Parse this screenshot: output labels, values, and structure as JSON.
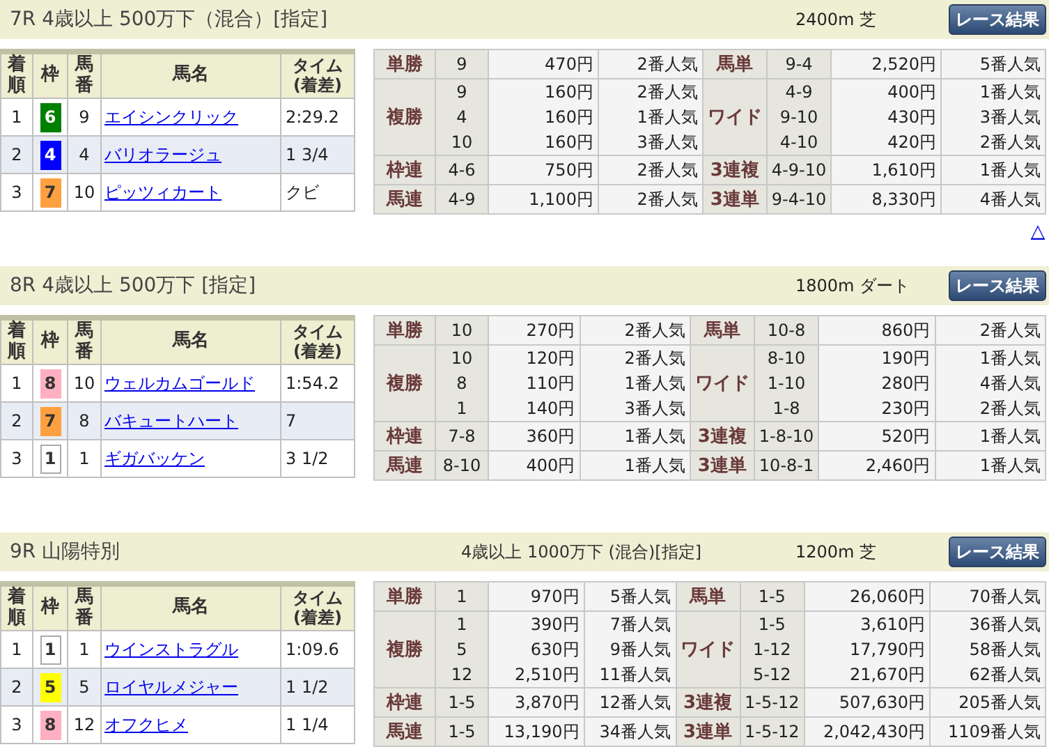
{
  "races": [
    {
      "title": "7R 4歳以上 500万下（混合）[指定]",
      "distance": "2400m 芝",
      "button": "レース結果",
      "columns": [
        "着順",
        "枠",
        "馬番",
        "馬名",
        "タイム(着差)"
      ],
      "results": [
        {
          "place": "1",
          "frame": "6",
          "color": "#008000",
          "number": "9",
          "name": "エイシンクリック",
          "time": "2:29.2"
        },
        {
          "place": "2",
          "frame": "4",
          "color": "#0000ff",
          "number": "4",
          "name": "バリオラージュ",
          "time": "1 3/4"
        },
        {
          "place": "3",
          "frame": "7",
          "color": "#ffa040",
          "number": "10",
          "name": "ピッツィカート",
          "time": "クビ"
        }
      ],
      "payouts": [
        {
          "label": "単勝",
          "entries": [
            {
              "combo": "9",
              "amount": "470円",
              "rank": "2番人気"
            }
          ],
          "label_2": "馬単",
          "entries_2": [
            {
              "combo": "9-4",
              "amount": "2,520円",
              "rank": "5番人気"
            }
          ]
        },
        {
          "label": "複勝",
          "entries": [
            {
              "combo": "9",
              "amount": "160円",
              "rank": "2番人気"
            },
            {
              "combo": "4",
              "amount": "160円",
              "rank": "1番人気"
            },
            {
              "combo": "10",
              "amount": "160円",
              "rank": "3番人気"
            }
          ],
          "label_2": "ワイド",
          "entries_2": [
            {
              "combo": "4-9",
              "amount": "400円",
              "rank": "1番人気"
            },
            {
              "combo": "9-10",
              "amount": "430円",
              "rank": "3番人気"
            },
            {
              "combo": "4-10",
              "amount": "420円",
              "rank": "2番人気"
            }
          ]
        },
        {
          "label": "枠連",
          "entries": [
            {
              "combo": "4-6",
              "amount": "750円",
              "rank": "2番人気"
            }
          ],
          "label_2": "3連複",
          "entries_2": [
            {
              "combo": "4-9-10",
              "amount": "1,610円",
              "rank": "1番人気"
            }
          ]
        },
        {
          "label": "馬連",
          "entries": [
            {
              "combo": "4-9",
              "amount": "1,100円",
              "rank": "2番人気"
            }
          ],
          "label_2": "3連単",
          "entries_2": [
            {
              "combo": "9-4-10",
              "amount": "8,330円",
              "rank": "4番人気"
            }
          ]
        }
      ],
      "back_link": "△"
    },
    {
      "title": "8R 4歳以上 500万下 [指定]",
      "distance": "1800m ダート",
      "button": "レース結果",
      "columns": [
        "着順",
        "枠",
        "馬番",
        "馬名",
        "タイム(着差)"
      ],
      "results": [
        {
          "place": "1",
          "frame": "8",
          "color": "#ffb0c0",
          "number": "10",
          "name": "ウェルカムゴールド",
          "time": "1:54.2"
        },
        {
          "place": "2",
          "frame": "7",
          "color": "#ffa040",
          "number": "8",
          "name": "バキュートハート",
          "time": "7"
        },
        {
          "place": "3",
          "frame": "1",
          "color": "#ffffff",
          "number": "1",
          "name": "ギガバッケン",
          "time": "3 1/2"
        }
      ],
      "payouts": [
        {
          "label": "単勝",
          "entries": [
            {
              "combo": "10",
              "amount": "270円",
              "rank": "2番人気"
            }
          ],
          "label_2": "馬単",
          "entries_2": [
            {
              "combo": "10-8",
              "amount": "860円",
              "rank": "2番人気"
            }
          ]
        },
        {
          "label": "複勝",
          "entries": [
            {
              "combo": "10",
              "amount": "120円",
              "rank": "2番人気"
            },
            {
              "combo": "8",
              "amount": "110円",
              "rank": "1番人気"
            },
            {
              "combo": "1",
              "amount": "140円",
              "rank": "3番人気"
            }
          ],
          "label_2": "ワイド",
          "entries_2": [
            {
              "combo": "8-10",
              "amount": "190円",
              "rank": "1番人気"
            },
            {
              "combo": "1-10",
              "amount": "280円",
              "rank": "4番人気"
            },
            {
              "combo": "1-8",
              "amount": "230円",
              "rank": "2番人気"
            }
          ]
        },
        {
          "label": "枠連",
          "entries": [
            {
              "combo": "7-8",
              "amount": "360円",
              "rank": "1番人気"
            }
          ],
          "label_2": "3連複",
          "entries_2": [
            {
              "combo": "1-8-10",
              "amount": "520円",
              "rank": "1番人気"
            }
          ]
        },
        {
          "label": "馬連",
          "entries": [
            {
              "combo": "8-10",
              "amount": "400円",
              "rank": "1番人気"
            }
          ],
          "label_2": "3連単",
          "entries_2": [
            {
              "combo": "10-8-1",
              "amount": "2,460円",
              "rank": "1番人気"
            }
          ]
        }
      ]
    },
    {
      "title": "9R 山陽特別",
      "subtitle": "4歳以上 1000万下 (混合)[指定]",
      "distance": "1200m 芝",
      "button": "レース結果",
      "columns": [
        "着順",
        "枠",
        "馬番",
        "馬名",
        "タイム(着差)"
      ],
      "results": [
        {
          "place": "1",
          "frame": "1",
          "color": "#ffffff",
          "number": "1",
          "name": "ウインストラグル",
          "time": "1:09.6"
        },
        {
          "place": "2",
          "frame": "5",
          "color": "#ffff00",
          "number": "5",
          "name": "ロイヤルメジャー",
          "time": "1 1/2"
        },
        {
          "place": "3",
          "frame": "8",
          "color": "#ffb0c0",
          "number": "12",
          "name": "オフクヒメ",
          "time": "1 1/4"
        }
      ],
      "payouts": [
        {
          "label": "単勝",
          "entries": [
            {
              "combo": "1",
              "amount": "970円",
              "rank": "5番人気"
            }
          ],
          "label_2": "馬単",
          "entries_2": [
            {
              "combo": "1-5",
              "amount": "26,060円",
              "rank": "70番人気"
            }
          ]
        },
        {
          "label": "複勝",
          "entries": [
            {
              "combo": "1",
              "amount": "390円",
              "rank": "7番人気"
            },
            {
              "combo": "5",
              "amount": "630円",
              "rank": "9番人気"
            },
            {
              "combo": "12",
              "amount": "2,510円",
              "rank": "11番人気"
            }
          ],
          "label_2": "ワイド",
          "entries_2": [
            {
              "combo": "1-5",
              "amount": "3,610円",
              "rank": "36番人気"
            },
            {
              "combo": "1-12",
              "amount": "17,790円",
              "rank": "58番人気"
            },
            {
              "combo": "5-12",
              "amount": "21,670円",
              "rank": "62番人気"
            }
          ]
        },
        {
          "label": "枠連",
          "entries": [
            {
              "combo": "1-5",
              "amount": "3,870円",
              "rank": "12番人気"
            }
          ],
          "label_2": "3連複",
          "entries_2": [
            {
              "combo": "1-5-12",
              "amount": "507,630円",
              "rank": "205番人気"
            }
          ]
        },
        {
          "label": "馬連",
          "entries": [
            {
              "combo": "1-5",
              "amount": "13,190円",
              "rank": "34番人気"
            }
          ],
          "label_2": "3連単",
          "entries_2": [
            {
              "combo": "1-5-12",
              "amount": "2,042,430円",
              "rank": "1109番人気"
            }
          ]
        }
      ]
    }
  ]
}
